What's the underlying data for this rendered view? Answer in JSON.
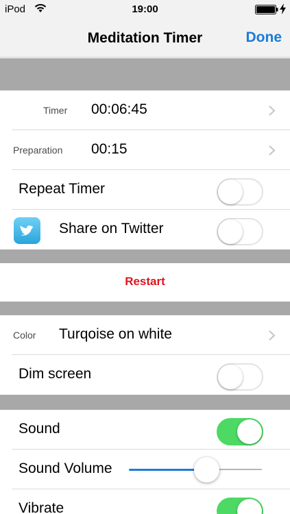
{
  "status_bar": {
    "carrier": "iPod",
    "time": "19:00",
    "wifi_icon": "wifi-icon",
    "battery_icon": "battery-full-icon",
    "charging_icon": "bolt-icon"
  },
  "nav": {
    "title": "Meditation Timer",
    "done_label": "Done"
  },
  "timer": {
    "label": "Timer",
    "value": "00:06:45"
  },
  "preparation": {
    "label": "Preparation",
    "value": "00:15"
  },
  "repeat": {
    "label": "Repeat Timer",
    "on": false
  },
  "twitter": {
    "label": "Share on Twitter",
    "on": false,
    "icon": "twitter-bird-icon"
  },
  "restart": {
    "label": "Restart",
    "color": "#e0141c"
  },
  "color": {
    "label": "Color",
    "value": "Turqoise on white"
  },
  "dim": {
    "label": "Dim screen",
    "on": false
  },
  "sound": {
    "label": "Sound",
    "on": true
  },
  "volume": {
    "label": "Sound Volume",
    "level": 0.58
  },
  "vibrate": {
    "label": "Vibrate",
    "on": true
  },
  "colors": {
    "accent": "#1a7bd9",
    "switch_on": "#4cd964",
    "separator": "#a8a8a8"
  }
}
